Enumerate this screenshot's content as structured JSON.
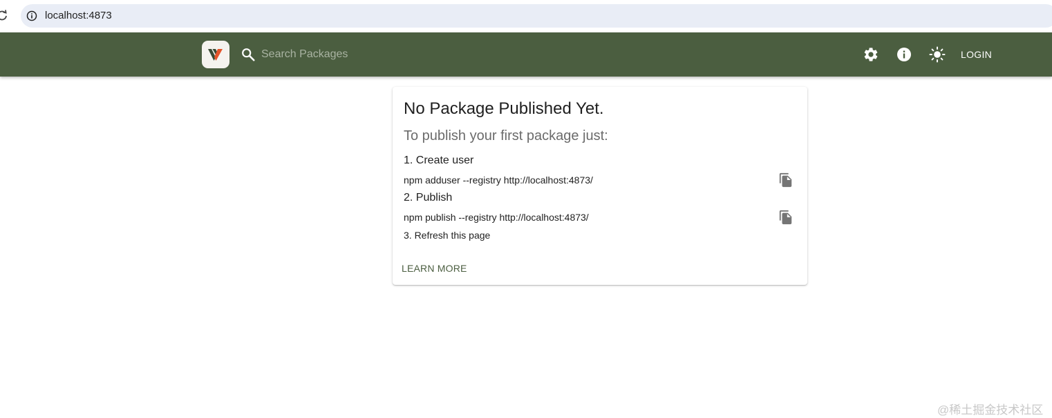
{
  "browser": {
    "url": "localhost:4873"
  },
  "header": {
    "search_placeholder": "Search Packages",
    "icons": [
      "settings-icon",
      "info-icon",
      "light-mode-icon"
    ],
    "login_label": "LOGIN",
    "background_color": "#4b5e40"
  },
  "card": {
    "title": "No Package Published Yet.",
    "subtitle": "To publish your first package just:",
    "steps": [
      {
        "title": "1. Create user",
        "command": "npm adduser --registry http://localhost:4873/"
      },
      {
        "title": "2. Publish",
        "command": "npm publish --registry http://localhost:4873/"
      },
      {
        "title": "3. Refresh this page"
      }
    ],
    "learn_more_label": "LEARN MORE"
  },
  "watermark": "@稀土掘金技术社区",
  "colors": {
    "accent": "#4b5e40",
    "logo_orange": "#e4542a",
    "logo_dark": "#3a4a34"
  }
}
